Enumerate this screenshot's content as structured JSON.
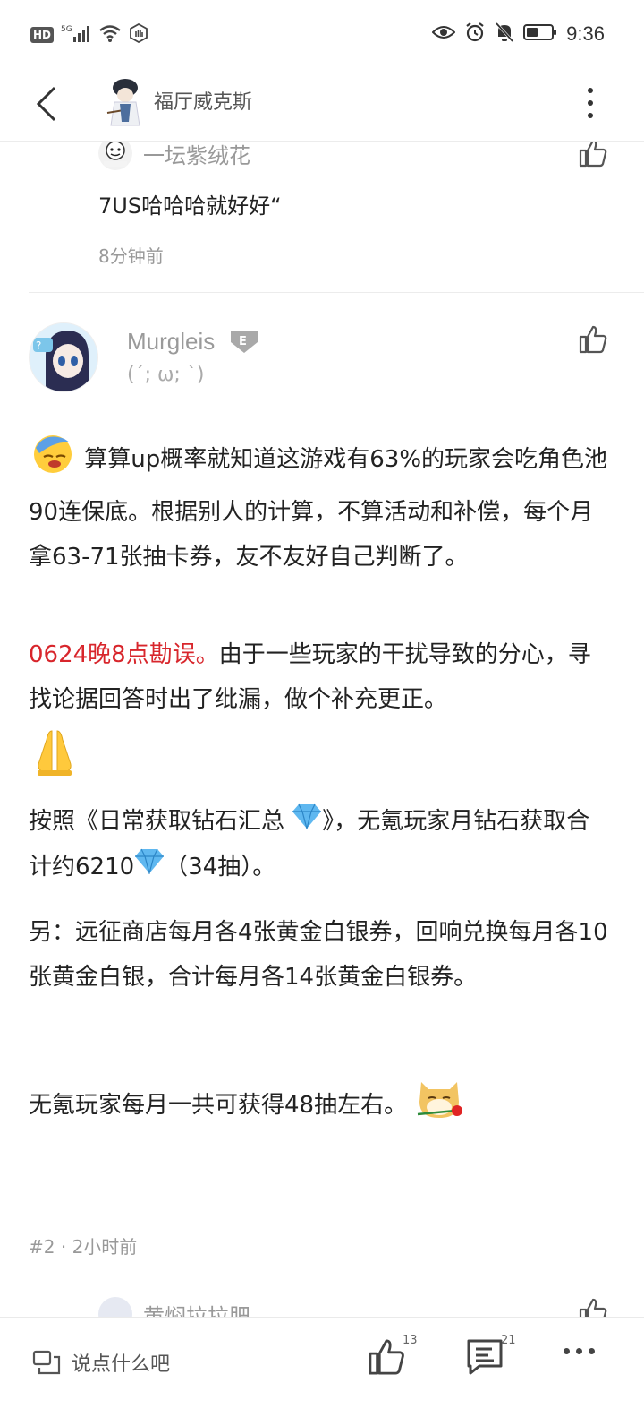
{
  "status_bar": {
    "hd": "HD",
    "network": "5G",
    "time": "9:36"
  },
  "header": {
    "title": "福厅威克斯"
  },
  "prev_reply": {
    "author": "一坛紫绒花",
    "text": "7US哈哈哈就好好“",
    "time": "8分钟前"
  },
  "comment": {
    "author": "Murgleis",
    "level": "E",
    "signature": "(´; ω; `)",
    "paragraphs": {
      "p1": "算算up概率就知道这游戏有63%的玩家会吃角色池90连保底。根据别人的计算，不算活动和补偿，每个月拿63-71张抽卡券，友不友好自己判断了。",
      "p2_red": "0624晚8点勘误。",
      "p2_rest": "由于一些玩家的干扰导致的分心，寻找论据回答时出了纰漏，做个补充更正。",
      "p3_a": "按照《日常获取钻石汇总",
      "p3_b": "》，无氪玩家月钻石获取合计约6210",
      "p3_c": "（34抽）。",
      "p4": "另：远征商店每月各4张黄金白银券，回响兑换每月各10张黄金白银，合计每月各14张黄金白银券。",
      "p5": "无氪玩家每月一共可获得48抽左右。"
    },
    "floor": "#2",
    "time": "2小时前"
  },
  "next_reply": {
    "author": "黄焖拉拉肥"
  },
  "bottom_bar": {
    "placeholder": "说点什么吧",
    "like_count": "13",
    "reply_count": "21"
  },
  "colors": {
    "accent_red": "#d8262c",
    "text_gray": "#999999"
  },
  "icons": [
    "back-arrow-icon",
    "more-vert-icon",
    "thumbs-up-icon",
    "comment-icon",
    "diamond-icon",
    "pray-icon",
    "doge-rose-icon",
    "facepalm-emoji-icon"
  ]
}
